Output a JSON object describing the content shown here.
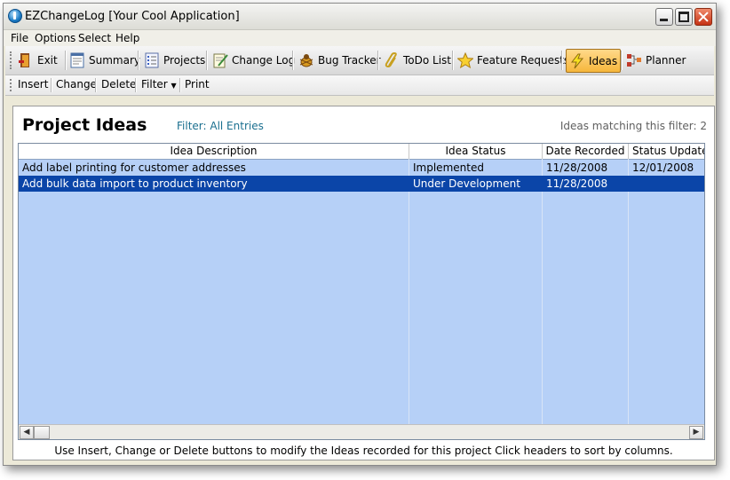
{
  "window": {
    "title": "EZChangeLog [Your Cool Application]"
  },
  "menu": [
    "File",
    "Options",
    "Select",
    "Help"
  ],
  "toolbar": [
    {
      "label": "Exit",
      "icon": "exit-door-icon"
    },
    {
      "label": "Summary",
      "icon": "summary-document-icon"
    },
    {
      "label": "Projects",
      "icon": "projects-list-icon"
    },
    {
      "label": "Change Log",
      "icon": "change-log-notepad-icon"
    },
    {
      "label": "Bug Tracker",
      "icon": "bug-icon"
    },
    {
      "label": "ToDo List",
      "icon": "paperclip-icon"
    },
    {
      "label": "Feature Requests",
      "icon": "star-icon"
    },
    {
      "label": "Ideas",
      "icon": "lightning-icon",
      "active": true
    },
    {
      "label": "Planner",
      "icon": "planner-flow-icon"
    }
  ],
  "actions": [
    "Insert",
    "Change",
    "Delete",
    "Filter",
    "Print"
  ],
  "panel": {
    "title": "Project Ideas",
    "filter": "Filter: All Entries",
    "match_count": "Ideas matching this filter: 2"
  },
  "grid": {
    "columns": [
      "Idea Description",
      "Idea Status",
      "Date Recorded",
      "Status Update"
    ],
    "rows": [
      {
        "description": "Add label printing for customer addresses",
        "status": "Implemented",
        "recorded": "11/28/2008",
        "updated": "12/01/2008",
        "selected": false
      },
      {
        "description": "Add bulk data import to product inventory",
        "status": "Under Development",
        "recorded": "11/28/2008",
        "updated": "",
        "selected": true
      }
    ]
  },
  "status_text": "Use Insert, Change or Delete buttons to modify the Ideas recorded for this project  Click headers to sort by columns.",
  "colors": {
    "grid_background": "#b6d0f7",
    "selection": "#0b45a8",
    "active_tool": "#f6b73c"
  }
}
